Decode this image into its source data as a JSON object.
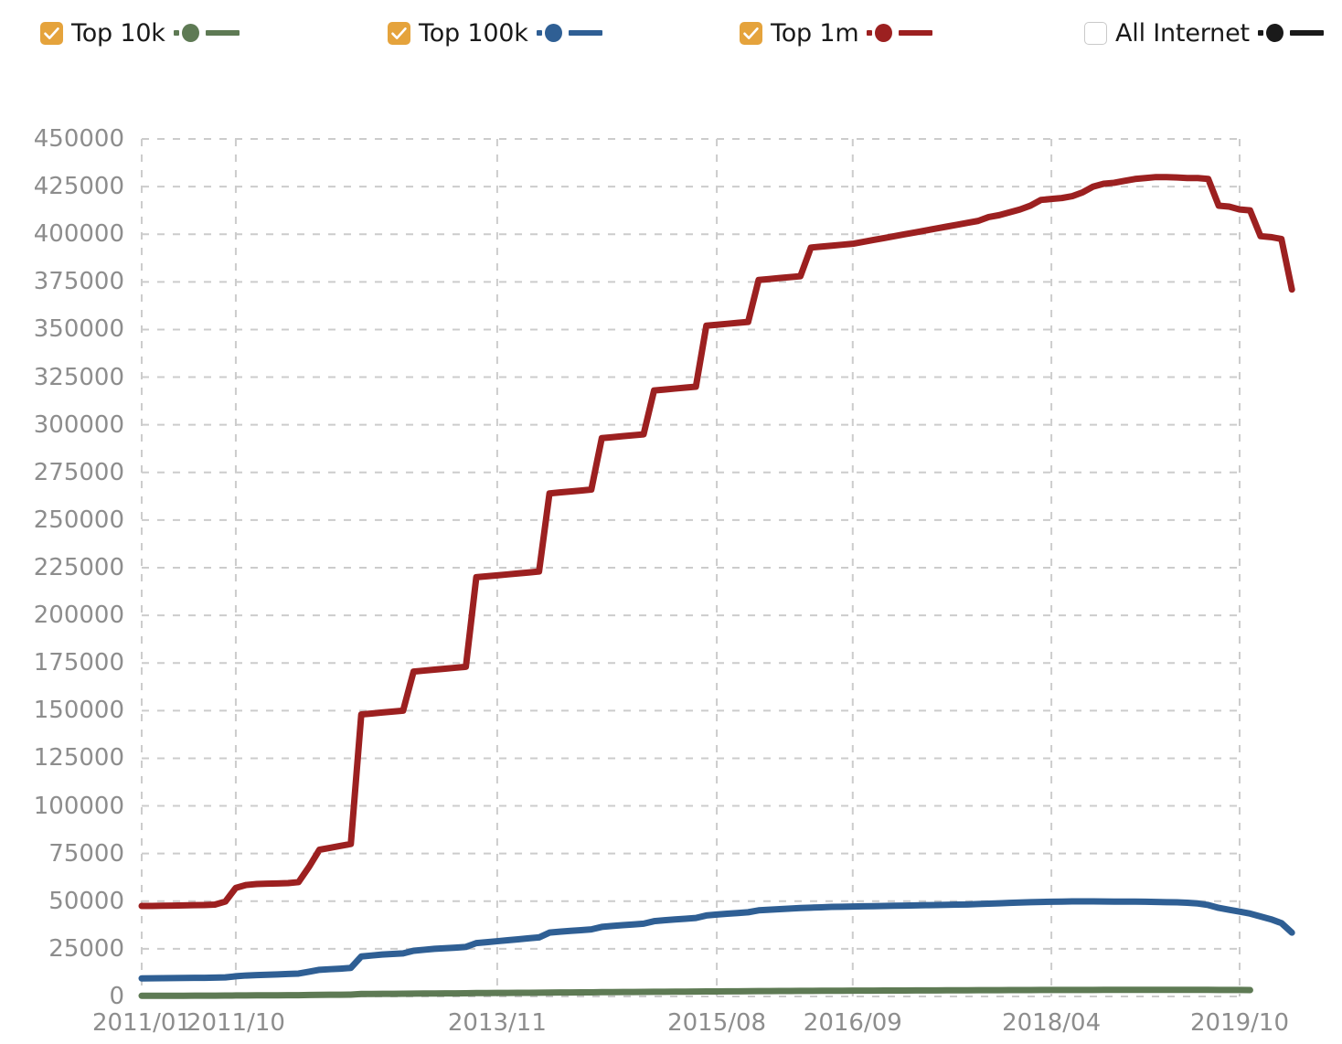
{
  "legend": {
    "items": [
      {
        "label": "Top 10k",
        "checked": true,
        "color": "#5e7a54",
        "icon": "checkbox-checked-icon",
        "x": 44
      },
      {
        "label": "Top 100k",
        "checked": true,
        "color": "#2f5f94",
        "icon": "checkbox-checked-icon",
        "x": 424
      },
      {
        "label": "Top 1m",
        "checked": true,
        "color": "#9c2020",
        "icon": "checkbox-checked-icon",
        "x": 809
      },
      {
        "label": "All Internet",
        "checked": false,
        "color": "#1a1a1a",
        "icon": "checkbox-unchecked-icon",
        "x": 1186
      }
    ]
  },
  "chart_data": {
    "type": "line",
    "title": "",
    "xlabel": "",
    "ylabel": "",
    "grid": true,
    "legend_position": "top",
    "ylim": [
      0,
      450000
    ],
    "ytick_step": 25000,
    "ytick_labels": [
      "450000",
      "425000",
      "400000",
      "375000",
      "350000",
      "325000",
      "300000",
      "275000",
      "250000",
      "225000",
      "200000",
      "175000",
      "150000",
      "125000",
      "100000",
      "75000",
      "50000",
      "25000",
      "0"
    ],
    "ytick_values": [
      450000,
      425000,
      400000,
      375000,
      350000,
      325000,
      300000,
      275000,
      250000,
      225000,
      200000,
      175000,
      150000,
      125000,
      100000,
      75000,
      50000,
      25000,
      0
    ],
    "xtick_labels": [
      "2011/01",
      "2011/10",
      "2013/11",
      "2015/08",
      "2016/09",
      "2018/04",
      "2019/10"
    ],
    "xtick_positions": [
      0,
      9,
      34,
      55,
      68,
      87,
      105
    ],
    "x_index_min": 0,
    "x_index_max": 105,
    "series": [
      {
        "name": "Top 1m",
        "color": "#9c2020",
        "values": [
          47500,
          47500,
          47600,
          47700,
          47800,
          47900,
          48000,
          48200,
          49800,
          57000,
          58500,
          59000,
          59200,
          59300,
          59500,
          60000,
          68000,
          77000,
          78000,
          79000,
          80000,
          148000,
          148500,
          149000,
          149500,
          150000,
          170500,
          171000,
          171500,
          172000,
          172500,
          173000,
          220000,
          220500,
          221000,
          221500,
          222000,
          222500,
          223000,
          264000,
          264500,
          265000,
          265500,
          266000,
          293000,
          293500,
          294000,
          294500,
          295000,
          318000,
          318500,
          319000,
          319500,
          320000,
          352000,
          352500,
          353000,
          353500,
          354000,
          376000,
          376500,
          377000,
          377500,
          378000,
          393000,
          393500,
          394000,
          394500,
          395000,
          396000,
          397000,
          398000,
          399000,
          400000,
          401000,
          402000,
          403000,
          404000,
          405000,
          406000,
          407000,
          409000,
          410000,
          411500,
          413000,
          415000,
          418000,
          418500,
          419000,
          420000,
          422000,
          425000,
          426500,
          427000,
          428000,
          429000,
          429500,
          430000,
          430000,
          429800,
          429500,
          429500,
          429000,
          415000,
          414500,
          413000,
          412500,
          399000,
          398500,
          397500,
          371000
        ]
      },
      {
        "name": "Top 100k",
        "color": "#2f5f94",
        "values": [
          9500,
          9550,
          9600,
          9650,
          9700,
          9750,
          9800,
          9900,
          10000,
          10600,
          11000,
          11200,
          11400,
          11600,
          11800,
          12000,
          13000,
          14000,
          14300,
          14600,
          15000,
          21000,
          21500,
          22000,
          22300,
          22600,
          24000,
          24500,
          25000,
          25300,
          25600,
          26000,
          28000,
          28500,
          29000,
          29500,
          30000,
          30500,
          31000,
          33500,
          34000,
          34400,
          34800,
          35200,
          36500,
          37000,
          37400,
          37800,
          38200,
          39500,
          40000,
          40400,
          40800,
          41200,
          42500,
          43000,
          43400,
          43800,
          44200,
          45200,
          45500,
          45800,
          46100,
          46400,
          46600,
          46800,
          47000,
          47100,
          47200,
          47300,
          47400,
          47500,
          47600,
          47700,
          47800,
          47900,
          48000,
          48100,
          48200,
          48300,
          48500,
          48700,
          48900,
          49100,
          49300,
          49500,
          49600,
          49700,
          49800,
          49900,
          49900,
          49900,
          49850,
          49800,
          49800,
          49750,
          49700,
          49600,
          49500,
          49400,
          49200,
          48800,
          48000,
          46500,
          45500,
          44500,
          43500,
          42000,
          40500,
          38500,
          33500
        ]
      },
      {
        "name": "Top 10k",
        "color": "#5e7a54",
        "values": [
          350,
          360,
          370,
          380,
          390,
          400,
          410,
          430,
          450,
          520,
          560,
          580,
          600,
          620,
          640,
          660,
          760,
          860,
          890,
          920,
          950,
          1300,
          1330,
          1360,
          1390,
          1420,
          1520,
          1550,
          1580,
          1610,
          1640,
          1670,
          1780,
          1810,
          1840,
          1870,
          1900,
          1930,
          1960,
          2050,
          2080,
          2110,
          2140,
          2170,
          2250,
          2280,
          2310,
          2340,
          2370,
          2440,
          2470,
          2500,
          2530,
          2560,
          2620,
          2650,
          2680,
          2710,
          2740,
          2800,
          2830,
          2860,
          2890,
          2920,
          2950,
          2970,
          2990,
          3010,
          3030,
          3050,
          3070,
          3090,
          3110,
          3130,
          3150,
          3170,
          3190,
          3210,
          3230,
          3250,
          3270,
          3290,
          3310,
          3330,
          3350,
          3370,
          3390,
          3400,
          3410,
          3420,
          3430,
          3440,
          3450,
          3460,
          3470,
          3480,
          3490,
          3500,
          3500,
          3495,
          3490,
          3480,
          3460,
          3440,
          3420,
          3400,
          3350
        ]
      }
    ]
  },
  "plot": {
    "grid_color": "#cccccc",
    "tick_text_color": "#8d8d8d",
    "background": "#ffffff"
  }
}
